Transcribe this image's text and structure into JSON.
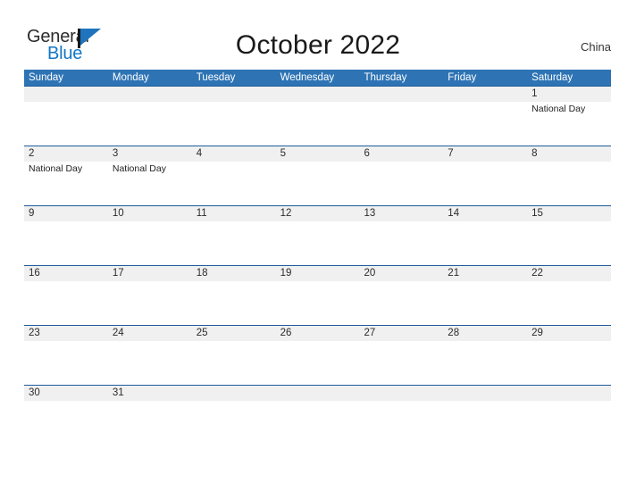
{
  "brand": {
    "name_top": "General",
    "name_bottom": "Blue",
    "top_color": "#2b2b2b",
    "bottom_color": "#1277c4",
    "flag_color": "#1f74bd"
  },
  "header": {
    "title": "October 2022",
    "region": "China"
  },
  "theme": {
    "header_blue": "#2e74b5",
    "row_divider": "#1f5c99",
    "band_gray": "#f0f0f0",
    "page_background": "#ffffff",
    "text_color": "#2b2b2b"
  },
  "calendar": {
    "month": "October",
    "year": "2022",
    "weekday_headers": [
      "Sunday",
      "Monday",
      "Tuesday",
      "Wednesday",
      "Thursday",
      "Friday",
      "Saturday"
    ],
    "weeks": [
      [
        {
          "day": "",
          "events": []
        },
        {
          "day": "",
          "events": []
        },
        {
          "day": "",
          "events": []
        },
        {
          "day": "",
          "events": []
        },
        {
          "day": "",
          "events": []
        },
        {
          "day": "",
          "events": []
        },
        {
          "day": "1",
          "events": [
            "National Day"
          ]
        }
      ],
      [
        {
          "day": "2",
          "events": [
            "National Day"
          ]
        },
        {
          "day": "3",
          "events": [
            "National Day"
          ]
        },
        {
          "day": "4",
          "events": []
        },
        {
          "day": "5",
          "events": []
        },
        {
          "day": "6",
          "events": []
        },
        {
          "day": "7",
          "events": []
        },
        {
          "day": "8",
          "events": []
        }
      ],
      [
        {
          "day": "9",
          "events": []
        },
        {
          "day": "10",
          "events": []
        },
        {
          "day": "11",
          "events": []
        },
        {
          "day": "12",
          "events": []
        },
        {
          "day": "13",
          "events": []
        },
        {
          "day": "14",
          "events": []
        },
        {
          "day": "15",
          "events": []
        }
      ],
      [
        {
          "day": "16",
          "events": []
        },
        {
          "day": "17",
          "events": []
        },
        {
          "day": "18",
          "events": []
        },
        {
          "day": "19",
          "events": []
        },
        {
          "day": "20",
          "events": []
        },
        {
          "day": "21",
          "events": []
        },
        {
          "day": "22",
          "events": []
        }
      ],
      [
        {
          "day": "23",
          "events": []
        },
        {
          "day": "24",
          "events": []
        },
        {
          "day": "25",
          "events": []
        },
        {
          "day": "26",
          "events": []
        },
        {
          "day": "27",
          "events": []
        },
        {
          "day": "28",
          "events": []
        },
        {
          "day": "29",
          "events": []
        }
      ],
      [
        {
          "day": "30",
          "events": []
        },
        {
          "day": "31",
          "events": []
        },
        {
          "day": "",
          "events": []
        },
        {
          "day": "",
          "events": []
        },
        {
          "day": "",
          "events": []
        },
        {
          "day": "",
          "events": []
        },
        {
          "day": "",
          "events": []
        }
      ]
    ]
  }
}
